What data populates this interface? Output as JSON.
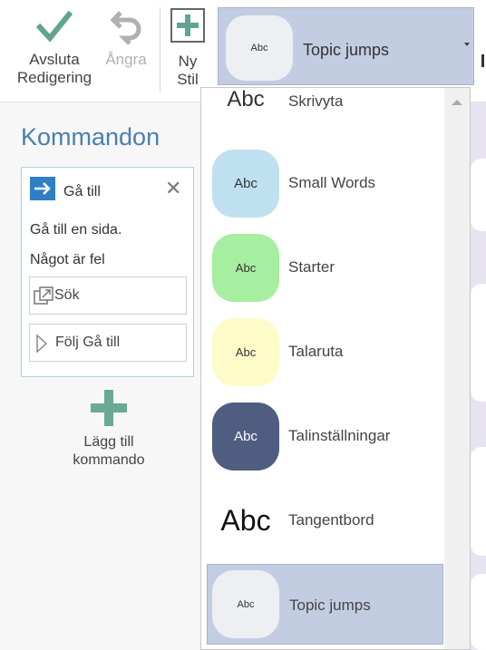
{
  "toolbar": {
    "finish_label_1": "Avsluta",
    "finish_label_2": "Redigering",
    "undo_label": "Ångra",
    "new_style_label_1": "Ny",
    "new_style_label_2": "Stil",
    "current_style": "Topic jumps",
    "current_style_sample": "Abc"
  },
  "commands": {
    "title": "Kommandon",
    "card": {
      "title": "Gå till",
      "line1": "Gå till en sida.",
      "line2": "Något är fel",
      "option1": "Sök",
      "option2": "Följ Gå till"
    },
    "add_label_1": "Lägg till",
    "add_label_2": "kommando"
  },
  "dropdown": {
    "items": [
      {
        "name": "Skrivyta",
        "sample": "Abc",
        "color": "#ffffff"
      },
      {
        "name": "Small Words",
        "sample": "Abc",
        "color": "#bfe0ef"
      },
      {
        "name": "Starter",
        "sample": "Abc",
        "color": "#a6eea0"
      },
      {
        "name": "Talaruta",
        "sample": "Abc",
        "color": "#fdfcc8"
      },
      {
        "name": "Talinställningar",
        "sample": "Abc",
        "color": "#4f5d80"
      },
      {
        "name": "Tangentbord",
        "sample": "Abc",
        "color": "#ffffff"
      },
      {
        "name": "Topic jumps",
        "sample": "Abc",
        "color": "#eeeff2"
      }
    ],
    "selected": "Topic jumps"
  },
  "colors": {
    "accent": "#4a7fb0",
    "selected_bg": "#c3cde2",
    "check_green": "#5fa58f"
  }
}
